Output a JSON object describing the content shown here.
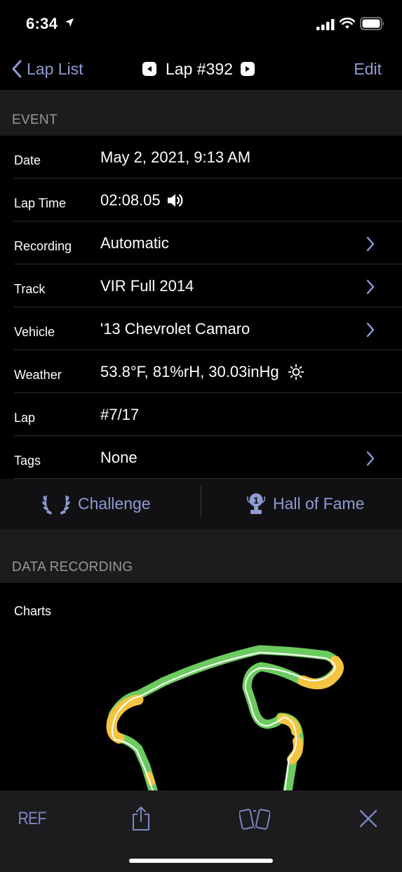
{
  "status": {
    "time": "6:34"
  },
  "nav": {
    "back_label": "Lap List",
    "title": "Lap #392",
    "edit_label": "Edit"
  },
  "sections": {
    "event": "EVENT",
    "data_recording": "DATA RECORDING"
  },
  "event_rows": [
    {
      "label": "Date",
      "value": "May 2, 2021, 9:13 AM"
    },
    {
      "label": "Lap Time",
      "value": "02:08.05",
      "icon": "speaker-icon"
    },
    {
      "label": "Recording",
      "value": "Automatic",
      "chevron": true
    },
    {
      "label": "Track",
      "value": "VIR Full 2014",
      "chevron": true
    },
    {
      "label": "Vehicle",
      "value": "'13 Chevrolet Camaro",
      "chevron": true
    },
    {
      "label": "Weather",
      "value": "53.8°F, 81%rH, 30.03inHg",
      "icon": "sun-icon"
    },
    {
      "label": "Lap",
      "value": "#7/17"
    },
    {
      "label": "Tags",
      "value": "None",
      "chevron": true
    }
  ],
  "actions": {
    "challenge": "Challenge",
    "hall_of_fame": "Hall of Fame",
    "hall_of_fame_badge": "1"
  },
  "charts": {
    "label": "Charts"
  },
  "toolbar": {
    "ref": "REF"
  },
  "colors": {
    "accent": "#8f9bd3",
    "track_green": "#6ccb5f",
    "track_yellow": "#f5c542"
  }
}
